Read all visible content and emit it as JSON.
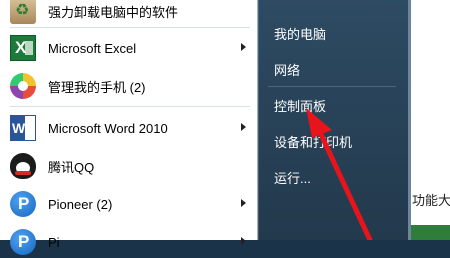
{
  "programs": [
    {
      "label": "强力卸载电脑中的软件",
      "icon": "uninstall-icon",
      "has_submenu": false
    },
    {
      "label": "Microsoft Excel",
      "icon": "excel-icon",
      "has_submenu": true
    },
    {
      "label": "管理我的手机 (2)",
      "icon": "phone-manager-icon",
      "has_submenu": true
    },
    {
      "label": "Microsoft Word 2010",
      "icon": "word-icon",
      "has_submenu": true
    },
    {
      "label": "腾讯QQ",
      "icon": "qq-icon",
      "has_submenu": false
    },
    {
      "label": "Pioneer (2)",
      "icon": "pioneer-icon",
      "has_submenu": true
    },
    {
      "label": "Pi",
      "icon": "pioneer-icon",
      "has_submenu": true
    }
  ],
  "right_menu": {
    "items": [
      "我的电脑",
      "网络",
      "控制面板",
      "设备和打印机",
      "运行..."
    ]
  },
  "desktop": {
    "text_fragment": "功能大"
  },
  "colors": {
    "annotation_arrow": "#e8141c",
    "right_pane": "#2d4b63"
  }
}
